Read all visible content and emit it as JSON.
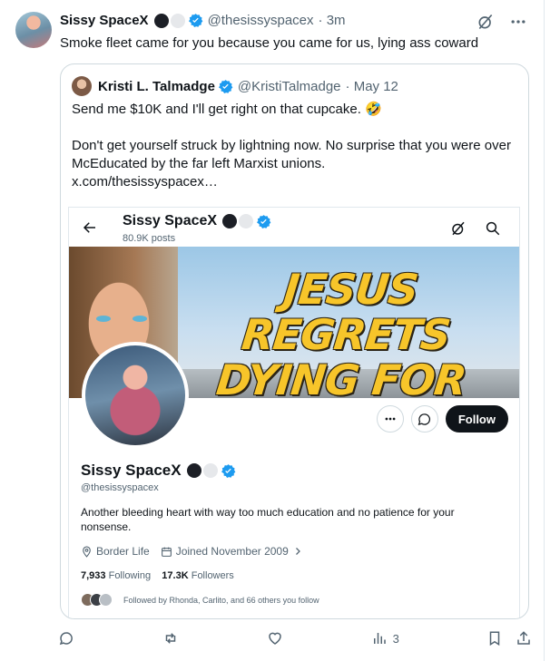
{
  "tweet": {
    "author_name": "Sissy SpaceX",
    "handle": "@thesissyspacex",
    "time": "· 3m",
    "text": "Smoke fleet came for you because you came for us, lying ass coward"
  },
  "quote": {
    "author_name": "Kristi L. Talmadge",
    "handle": "@KristiTalmadge",
    "date": "· May 12",
    "paragraph1": "Send me $10K and I'll get right on that cupcake. 🤣",
    "paragraph2": "Don't get yourself struck by lightning now. No surprise that you were over McEducated by the far left Marxist unions.",
    "link": "x.com/thesissyspacex…"
  },
  "profile": {
    "name": "Sissy SpaceX",
    "posts": "80.9K posts",
    "banner_line1": "JESUS REGRETS",
    "banner_line2": "DYING FOR YOU",
    "follow_label": "Follow",
    "handle": "@thesissyspacex",
    "bio": "Another bleeding heart with way too much education and no patience for your nonsense.",
    "location": "Border Life",
    "joined": "Joined November 2009",
    "following_count": "7,933",
    "following_label": "Following",
    "followers_count": "17.3K",
    "followers_label": "Followers",
    "followed_by": "Followed by Rhonda, Carlito, and 66 others you follow"
  },
  "actions": {
    "views_count": "3"
  },
  "colors": {
    "verified": "#1d9bf0",
    "muted_text": "#536471",
    "banner_text": "#f7c52a"
  }
}
